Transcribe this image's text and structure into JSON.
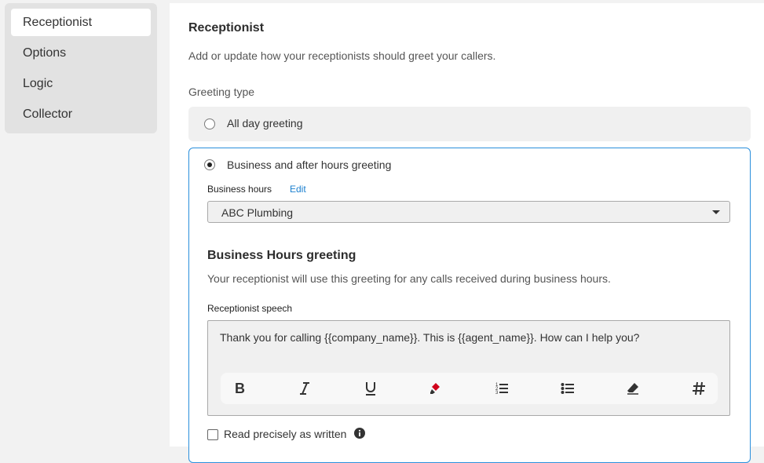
{
  "sidebar": {
    "items": [
      {
        "label": "Receptionist",
        "active": true
      },
      {
        "label": "Options",
        "active": false
      },
      {
        "label": "Logic",
        "active": false
      },
      {
        "label": "Collector",
        "active": false
      }
    ]
  },
  "main": {
    "title": "Receptionist",
    "description": "Add or update how your receptionists should greet your callers.",
    "greeting_type_label": "Greeting type",
    "options": [
      {
        "label": "All day greeting",
        "selected": false
      },
      {
        "label": "Business and after hours greeting",
        "selected": true
      }
    ],
    "business_hours_label": "Business hours",
    "edit_label": "Edit",
    "business_hours_value": "ABC Plumbing",
    "bh_greeting_title": "Business Hours greeting",
    "bh_greeting_desc": "Your receptionist will use this greeting for any calls received during business hours.",
    "speech_label": "Receptionist speech",
    "speech_text": "Thank you for calling {{company_name}}. This is {{agent_name}}. How can I help you?",
    "toolbar": [
      "bold-icon",
      "italic-icon",
      "underline-icon",
      "highlight-icon",
      "ordered-list-icon",
      "bullet-list-icon",
      "eraser-icon",
      "hashtag-icon"
    ],
    "read_precisely_label": "Read precisely as written",
    "read_precisely_checked": false
  },
  "colors": {
    "accent": "#2a8fdc",
    "link": "#1a7fcf",
    "highlight": "#d0021b"
  }
}
